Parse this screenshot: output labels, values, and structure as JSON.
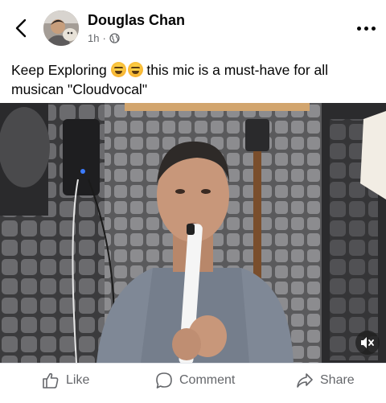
{
  "header": {
    "author_name": "Douglas Chan",
    "time_ago": "1h",
    "audience_icon": "globe-icon"
  },
  "post": {
    "text_before": "Keep Exploring ",
    "text_after": " this mic is a must-have for all musican \"Cloudvocal\"",
    "emoji": "grinning-squinting-face"
  },
  "video": {
    "mute_icon": "speaker-muted-icon"
  },
  "actions": {
    "like_label": "Like",
    "comment_label": "Comment",
    "share_label": "Share"
  },
  "colors": {
    "secondary_text": "#65676b",
    "primary_text": "#050505",
    "divider": "#e4e6eb"
  }
}
